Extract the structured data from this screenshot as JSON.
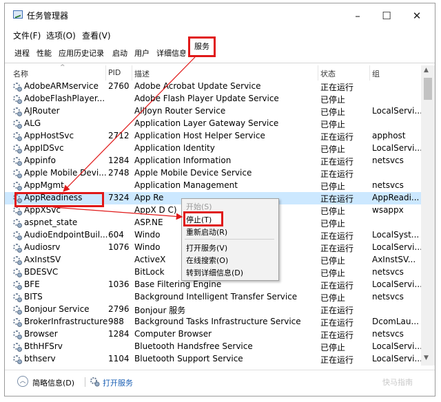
{
  "window": {
    "title": "任务管理器",
    "controls": {
      "minimize": "–",
      "maximize": "☐",
      "close": "✕"
    }
  },
  "menu": [
    "文件(F)",
    "选项(O)",
    "查看(V)"
  ],
  "tabs": [
    "进程",
    "性能",
    "应用历史记录",
    "启动",
    "用户",
    "详细信息",
    "服务"
  ],
  "active_tab": "服务",
  "columns": {
    "name": "名称",
    "pid": "PID",
    "desc": "描述",
    "status": "状态",
    "group": "组"
  },
  "rows": [
    {
      "name": "AdobeARMservice",
      "pid": "2760",
      "desc": "Adobe Acrobat Update Service",
      "status": "正在运行",
      "group": ""
    },
    {
      "name": "AdobeFlashPlayer...",
      "pid": "",
      "desc": "Adobe Flash Player Update Service",
      "status": "已停止",
      "group": ""
    },
    {
      "name": "AJRouter",
      "pid": "",
      "desc": "AllJoyn Router Service",
      "status": "已停止",
      "group": "LocalServi..."
    },
    {
      "name": "ALG",
      "pid": "",
      "desc": "Application Layer Gateway Service",
      "status": "已停止",
      "group": ""
    },
    {
      "name": "AppHostSvc",
      "pid": "2712",
      "desc": "Application Host Helper Service",
      "status": "正在运行",
      "group": "apphost"
    },
    {
      "name": "AppIDSvc",
      "pid": "",
      "desc": "Application Identity",
      "status": "已停止",
      "group": "LocalServi..."
    },
    {
      "name": "Appinfo",
      "pid": "1284",
      "desc": "Application Information",
      "status": "正在运行",
      "group": "netsvcs"
    },
    {
      "name": "Apple Mobile Devi...",
      "pid": "2748",
      "desc": "Apple Mobile Device Service",
      "status": "正在运行",
      "group": ""
    },
    {
      "name": "AppMgmt",
      "pid": "",
      "desc": "Application Management",
      "status": "已停止",
      "group": "netsvcs"
    },
    {
      "name": "AppReadiness",
      "pid": "7324",
      "desc": "App Re",
      "status": "正在运行",
      "group": "AppReadi..."
    },
    {
      "name": "AppXSvc",
      "pid": "",
      "desc": "AppX D                          C)",
      "status": "已停止",
      "group": "wsappx"
    },
    {
      "name": "aspnet_state",
      "pid": "",
      "desc": "ASP.NE",
      "status": "已停止",
      "group": ""
    },
    {
      "name": "AudioEndpointBuil...",
      "pid": "604",
      "desc": "Windo",
      "status": "正在运行",
      "group": "LocalSyst..."
    },
    {
      "name": "Audiosrv",
      "pid": "1076",
      "desc": "Windo",
      "status": "正在运行",
      "group": "LocalServi..."
    },
    {
      "name": "AxInstSV",
      "pid": "",
      "desc": "ActiveX",
      "status": "已停止",
      "group": "AxInstSV..."
    },
    {
      "name": "BDESVC",
      "pid": "",
      "desc": "BitLock",
      "status": "已停止",
      "group": "netsvcs"
    },
    {
      "name": "BFE",
      "pid": "1036",
      "desc": "Base Filtering Engine",
      "status": "正在运行",
      "group": "LocalServi..."
    },
    {
      "name": "BITS",
      "pid": "",
      "desc": "Background Intelligent Transfer Service",
      "status": "已停止",
      "group": "netsvcs"
    },
    {
      "name": "Bonjour Service",
      "pid": "2796",
      "desc": "Bonjour 服务",
      "status": "正在运行",
      "group": ""
    },
    {
      "name": "BrokerInfrastructure",
      "pid": "988",
      "desc": "Background Tasks Infrastructure Service",
      "status": "正在运行",
      "group": "DcomLau..."
    },
    {
      "name": "Browser",
      "pid": "1284",
      "desc": "Computer Browser",
      "status": "正在运行",
      "group": "netsvcs"
    },
    {
      "name": "BthHFSrv",
      "pid": "",
      "desc": "Bluetooth Handsfree Service",
      "status": "已停止",
      "group": "LocalServi..."
    },
    {
      "name": "bthserv",
      "pid": "1104",
      "desc": "Bluetooth Support Service",
      "status": "正在运行",
      "group": "LocalServi..."
    }
  ],
  "context_menu": [
    "开始(S)",
    "停止(T)",
    "重新启动(R)",
    "打开服务(V)",
    "在线搜索(O)",
    "转到详细信息(D)"
  ],
  "footer": {
    "fewer_details": "简略信息(D)",
    "open_services": "打开服务"
  },
  "watermark": "快马指南",
  "colors": {
    "highlight": "#e01818",
    "selected_row": "#cce8ff",
    "link": "#1a5fb4"
  }
}
